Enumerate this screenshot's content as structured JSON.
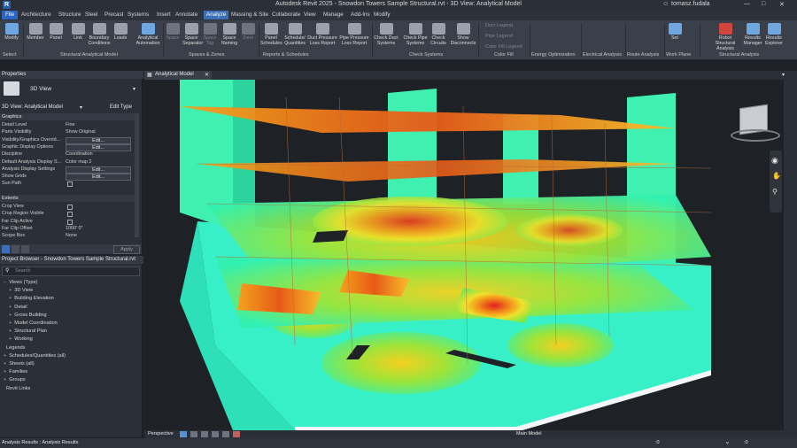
{
  "app": {
    "title": "Autodesk Revit 2025 - Snowdon Towers Sample Structural.rvt - 3D View: Analytical Model",
    "user": "tomasz.fudala"
  },
  "menu": {
    "file": "File",
    "tabs": [
      "Architecture",
      "Structure",
      "Steel",
      "Precast",
      "Systems",
      "Insert",
      "Annotate",
      "Analyze",
      "Massing & Site",
      "Collaborate",
      "View",
      "Manage",
      "Add-Ins",
      "Modify"
    ],
    "active": "Analyze"
  },
  "ribbon": {
    "buttons": [
      {
        "label": "Modify",
        "icon": "cursor-icon",
        "color": "#6fa8e0"
      },
      {
        "label": "Member",
        "icon": "member-icon",
        "color": "#9aa1ab"
      },
      {
        "label": "Panel",
        "icon": "panel-icon",
        "color": "#9aa1ab"
      },
      {
        "label": "Link",
        "icon": "link-icon",
        "color": "#9aa1ab"
      },
      {
        "label": "Boundary\nConditions",
        "icon": "boundary-icon",
        "color": "#9aa1ab"
      },
      {
        "label": "Loads",
        "icon": "loads-icon",
        "color": "#9aa1ab"
      },
      {
        "label": "Analytical\nAutomation",
        "icon": "automation-icon",
        "color": "#6fa8e0"
      },
      {
        "label": "Space",
        "icon": "space-icon",
        "color": "#6d7480"
      },
      {
        "label": "Space\nSeparator",
        "icon": "separator-icon",
        "color": "#9aa1ab"
      },
      {
        "label": "Space\nTag",
        "icon": "tag-icon",
        "color": "#6d7480"
      },
      {
        "label": "Space\nNaming",
        "icon": "naming-icon",
        "color": "#9aa1ab"
      },
      {
        "label": "Zone",
        "icon": "zone-icon",
        "color": "#6d7480"
      },
      {
        "label": "Panel\nSchedules",
        "icon": "schedule-icon",
        "color": "#9aa1ab"
      },
      {
        "label": "Schedule/\nQuantities",
        "icon": "quantities-icon",
        "color": "#9aa1ab"
      },
      {
        "label": "Duct Pressure\nLoss Report",
        "icon": "duct-icon",
        "color": "#9aa1ab"
      },
      {
        "label": "Pipe Pressure\nLoss Report",
        "icon": "pipe-icon",
        "color": "#9aa1ab"
      },
      {
        "label": "Check Duct\nSystems",
        "icon": "check-duct-icon",
        "color": "#9aa1ab"
      },
      {
        "label": "Check Pipe\nSystems",
        "icon": "check-pipe-icon",
        "color": "#9aa1ab"
      },
      {
        "label": "Check\nCircuits",
        "icon": "circuits-icon",
        "color": "#9aa1ab"
      },
      {
        "label": "Show\nDisconnects",
        "icon": "disconnect-icon",
        "color": "#9aa1ab"
      },
      {
        "label": "Set",
        "icon": "set-icon",
        "color": "#6fa8e0"
      },
      {
        "label": "Robot\nStructural Analysis",
        "icon": "robot-icon",
        "color": "#d0463e"
      },
      {
        "label": "Results\nManager",
        "icon": "results-manager-icon",
        "color": "#6fa8e0"
      },
      {
        "label": "Results\nExplorer",
        "icon": "results-explorer-icon",
        "color": "#6fa8e0"
      }
    ],
    "legends": [
      "Duct Legend",
      "Pipe Legend",
      "Color Fill Legend"
    ],
    "panels": [
      "Select",
      "Structural Analytical Model",
      "Spaces & Zones",
      "Reports & Schedules",
      "Check Systems",
      "Color Fill",
      "Energy Optimization",
      "Electrical Analysis",
      "Route Analysis",
      "Work Plane",
      "Structural Analysis"
    ]
  },
  "properties": {
    "header": "Properties",
    "type_name": "3D View",
    "instance": "3D View: Analytical Model",
    "edit_type": "Edit Type",
    "sections": {
      "graphics": "Graphics",
      "extents": "Extents"
    },
    "rows": [
      {
        "k": "Detail Level",
        "v": "Fine"
      },
      {
        "k": "Parts Visibility",
        "v": "Show Original"
      },
      {
        "k": "Visibility/Graphics Overrid...",
        "btn": "Edit..."
      },
      {
        "k": "Graphic Display Options",
        "btn": "Edit..."
      },
      {
        "k": "Discipline",
        "v": "Coordination"
      },
      {
        "k": "Default Analysis Display S...",
        "v": "Color map 2"
      },
      {
        "k": "Analysis Display Settings",
        "btn": "Edit..."
      },
      {
        "k": "Show Grids",
        "btn": "Edit..."
      },
      {
        "k": "Sun Path",
        "cb": true
      }
    ],
    "extents": [
      {
        "k": "Crop View",
        "cb": true
      },
      {
        "k": "Crop Region Visible",
        "cb": true
      },
      {
        "k": "Far Clip Active",
        "cb": true
      },
      {
        "k": "Far Clip Offset",
        "v": "1000' 0\""
      },
      {
        "k": "Scope Box",
        "v": "None"
      }
    ],
    "apply": "Apply"
  },
  "browser": {
    "header": "Project Browser - Snowdon Towers Sample Structural.rvt",
    "search_placeholder": "Search",
    "items": [
      {
        "label": "Views (Type)",
        "level": 0,
        "tw": "−"
      },
      {
        "label": "3D View",
        "level": 1,
        "tw": "+"
      },
      {
        "label": "Building Elevation",
        "level": 1,
        "tw": "+"
      },
      {
        "label": "Detail",
        "level": 1,
        "tw": "+"
      },
      {
        "label": "Gross Building",
        "level": 1,
        "tw": "+"
      },
      {
        "label": "Model Coordination",
        "level": 1,
        "tw": "+"
      },
      {
        "label": "Structural Plan",
        "level": 1,
        "tw": "+"
      },
      {
        "label": "Working",
        "level": 1,
        "tw": "+"
      },
      {
        "label": "Legends",
        "level": 0,
        "tw": " "
      },
      {
        "label": "Schedules/Quantities (all)",
        "level": 0,
        "tw": "+"
      },
      {
        "label": "Sheets (all)",
        "level": 0,
        "tw": "+"
      },
      {
        "label": "Families",
        "level": 0,
        "tw": "+"
      },
      {
        "label": "Groups",
        "level": 0,
        "tw": "+"
      },
      {
        "label": "Revit Links",
        "level": 0,
        "tw": " "
      }
    ]
  },
  "view": {
    "tab": "Analytical Model",
    "mode": "Perspective",
    "model": "Main Model"
  },
  "status": {
    "text": "Analysis Results : Analysis Results",
    "zero": ":0"
  }
}
